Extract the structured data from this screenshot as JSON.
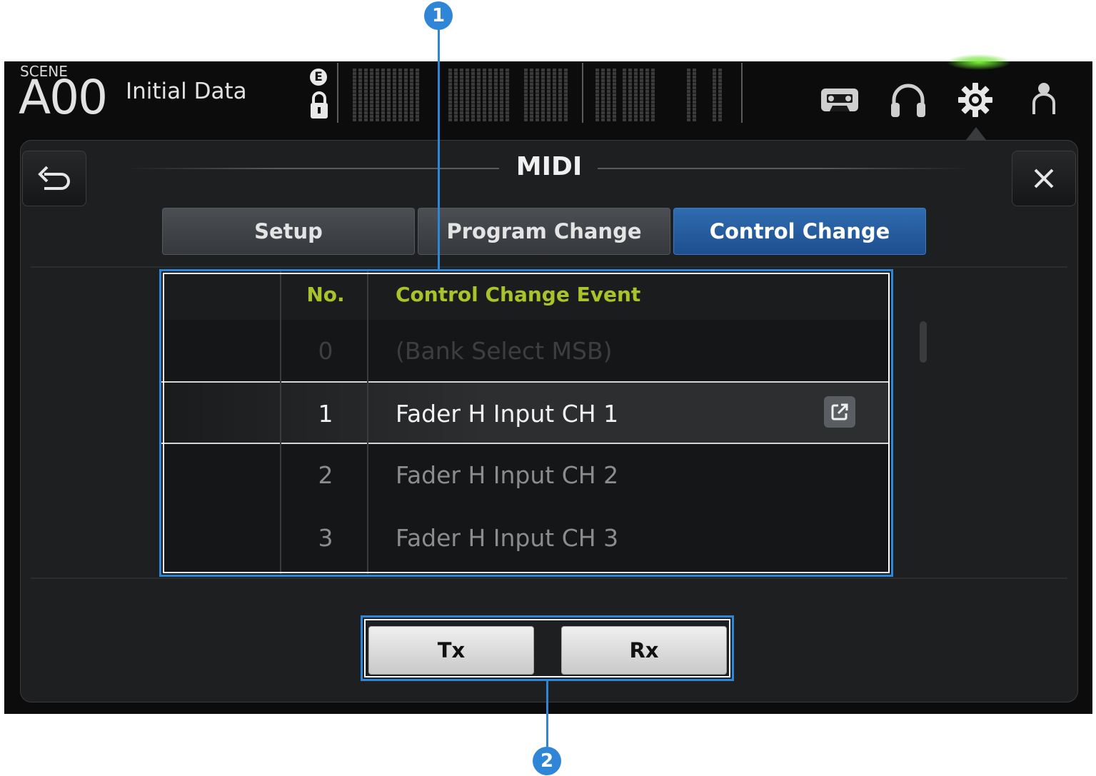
{
  "header": {
    "scene_label": "SCENE",
    "scene_number": "A00",
    "scene_name": "Initial Data",
    "edit_indicator": "E",
    "icons": [
      "recorder-icon",
      "headphones-icon",
      "settings-gear-icon",
      "user-icon"
    ]
  },
  "panel": {
    "title": "MIDI",
    "tabs": [
      {
        "label": "Setup",
        "active": false
      },
      {
        "label": "Program Change",
        "active": false
      },
      {
        "label": "Control Change",
        "active": true
      }
    ]
  },
  "table": {
    "columns": {
      "no": "No.",
      "event": "Control Change Event"
    },
    "rows": [
      {
        "no": "0",
        "event": "(Bank Select MSB)"
      },
      {
        "no": "1",
        "event": "Fader H Input CH 1",
        "selected": true
      },
      {
        "no": "2",
        "event": "Fader H Input CH 2"
      },
      {
        "no": "3",
        "event": "Fader H Input CH 3"
      }
    ]
  },
  "buttons": {
    "tx": "Tx",
    "rx": "Rx"
  },
  "callouts": {
    "one": "1",
    "two": "2"
  },
  "colors": {
    "accent_blue": "#2f86d6",
    "active_tab": "#2f6cb0",
    "header_green": "#a9c42a"
  }
}
